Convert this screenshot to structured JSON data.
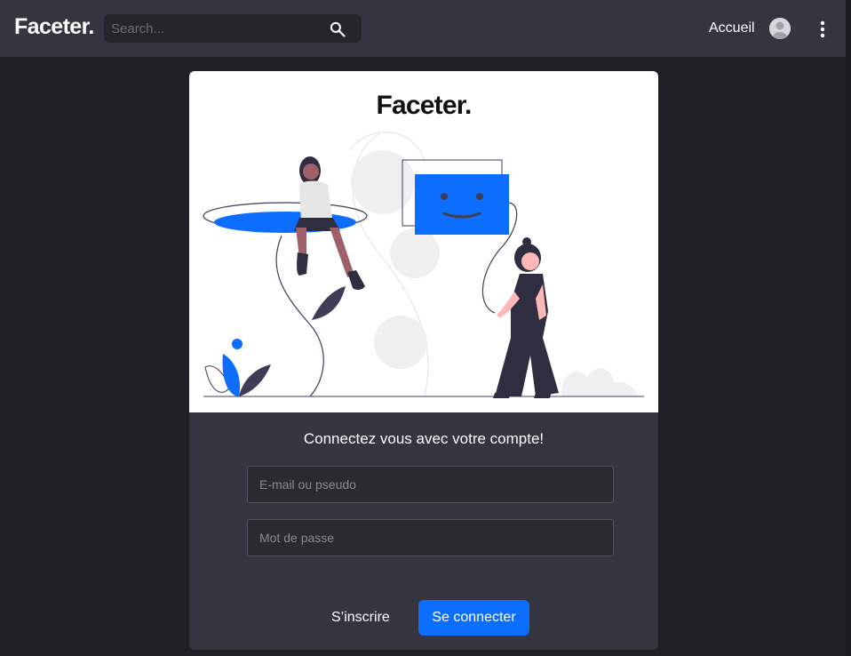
{
  "navbar": {
    "brand": "Faceter.",
    "search": {
      "placeholder": "Search..."
    },
    "home_link": "Accueil"
  },
  "card": {
    "illustration_brand": "Faceter.",
    "form_title": "Connectez vous avec votre compte!",
    "email_field": {
      "placeholder": "E-mail ou pseudo",
      "value": ""
    },
    "password_field": {
      "placeholder": "Mot de passe",
      "value": ""
    },
    "register_link": "S’inscrire",
    "login_button": "Se connecter"
  },
  "colors": {
    "navbar_bg": "#35353f",
    "page_bg": "#212125",
    "accent": "#0d6efd",
    "card_bg": "#35353f"
  },
  "icons": [
    "search-icon",
    "avatar",
    "more-vertical-icon"
  ]
}
